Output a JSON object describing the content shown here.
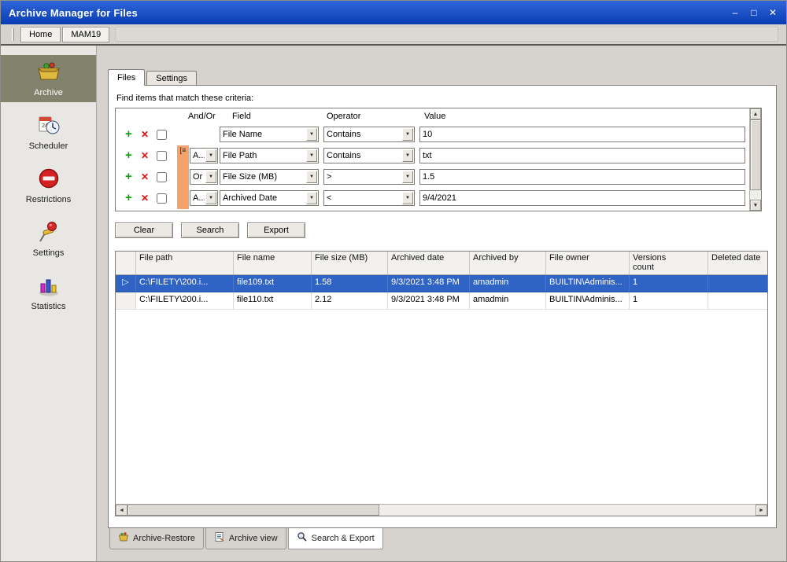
{
  "colors": {
    "titlebar_top": "#2f66d8",
    "titlebar_bottom": "#0a3db4",
    "selection": "#2f63c4",
    "sidebar_selected": "#82826d",
    "group_bracket": "#f2a36e"
  },
  "window": {
    "title": "Archive Manager for Files",
    "controls": {
      "minimize": "–",
      "maximize": "□",
      "close": "✕"
    }
  },
  "toolbar": {
    "items": [
      {
        "label": "Home"
      },
      {
        "label": "MAM19"
      }
    ]
  },
  "sidebar": {
    "items": [
      {
        "label": "Archive",
        "icon": "archive-icon",
        "selected": true
      },
      {
        "label": "Scheduler",
        "icon": "scheduler-icon",
        "selected": false
      },
      {
        "label": "Restrictions",
        "icon": "restrictions-icon",
        "selected": false
      },
      {
        "label": "Settings",
        "icon": "settings-icon",
        "selected": false
      },
      {
        "label": "Statistics",
        "icon": "statistics-icon",
        "selected": false
      }
    ]
  },
  "main": {
    "tabs": [
      {
        "label": "Files",
        "active": true
      },
      {
        "label": "Settings",
        "active": false
      }
    ],
    "criteria": {
      "caption": "Find items that match these criteria:",
      "headers": {
        "andor": "And/Or",
        "field": "Field",
        "operator": "Operator",
        "value": "Value"
      },
      "rows": [
        {
          "andor": null,
          "field": "File Name",
          "operator": "Contains",
          "value": "10",
          "grouped": false,
          "bracket_icon": null
        },
        {
          "andor": "A...",
          "field": "File Path",
          "operator": "Contains",
          "value": "txt",
          "grouped": true,
          "bracket_icon": "[≡"
        },
        {
          "andor": "Or",
          "field": "File Size (MB)",
          "operator": ">",
          "value": "1.5",
          "grouped": true,
          "bracket_icon": null
        },
        {
          "andor": "A...",
          "field": "Archived Date",
          "operator": "<",
          "value": "9/4/2021",
          "grouped": true,
          "bracket_icon": null
        }
      ]
    },
    "buttons": [
      {
        "label": "Clear"
      },
      {
        "label": "Search"
      },
      {
        "label": "Export"
      }
    ],
    "results": {
      "columns": [
        "",
        "File path",
        "File name",
        "File size (MB)",
        "Archived date",
        "Archived by",
        "File owner",
        "Versions count",
        "Deleted date"
      ],
      "rows": [
        {
          "selected": true,
          "cells": [
            "C:\\FILETY\\200.i...",
            "file109.txt",
            "1.58",
            "9/3/2021 3:48 PM",
            "amadmin",
            "BUILTIN\\Adminis...",
            "1",
            ""
          ]
        },
        {
          "selected": false,
          "cells": [
            "C:\\FILETY\\200.i...",
            "file110.txt",
            "2.12",
            "9/3/2021 3:48 PM",
            "amadmin",
            "BUILTIN\\Adminis...",
            "1",
            ""
          ]
        }
      ]
    }
  },
  "bottom_tabs": [
    {
      "label": "Archive-Restore",
      "icon": "archive-restore-icon",
      "active": false
    },
    {
      "label": "Archive view",
      "icon": "archive-view-icon",
      "active": false
    },
    {
      "label": "Search & Export",
      "icon": "search-export-icon",
      "active": true
    }
  ]
}
